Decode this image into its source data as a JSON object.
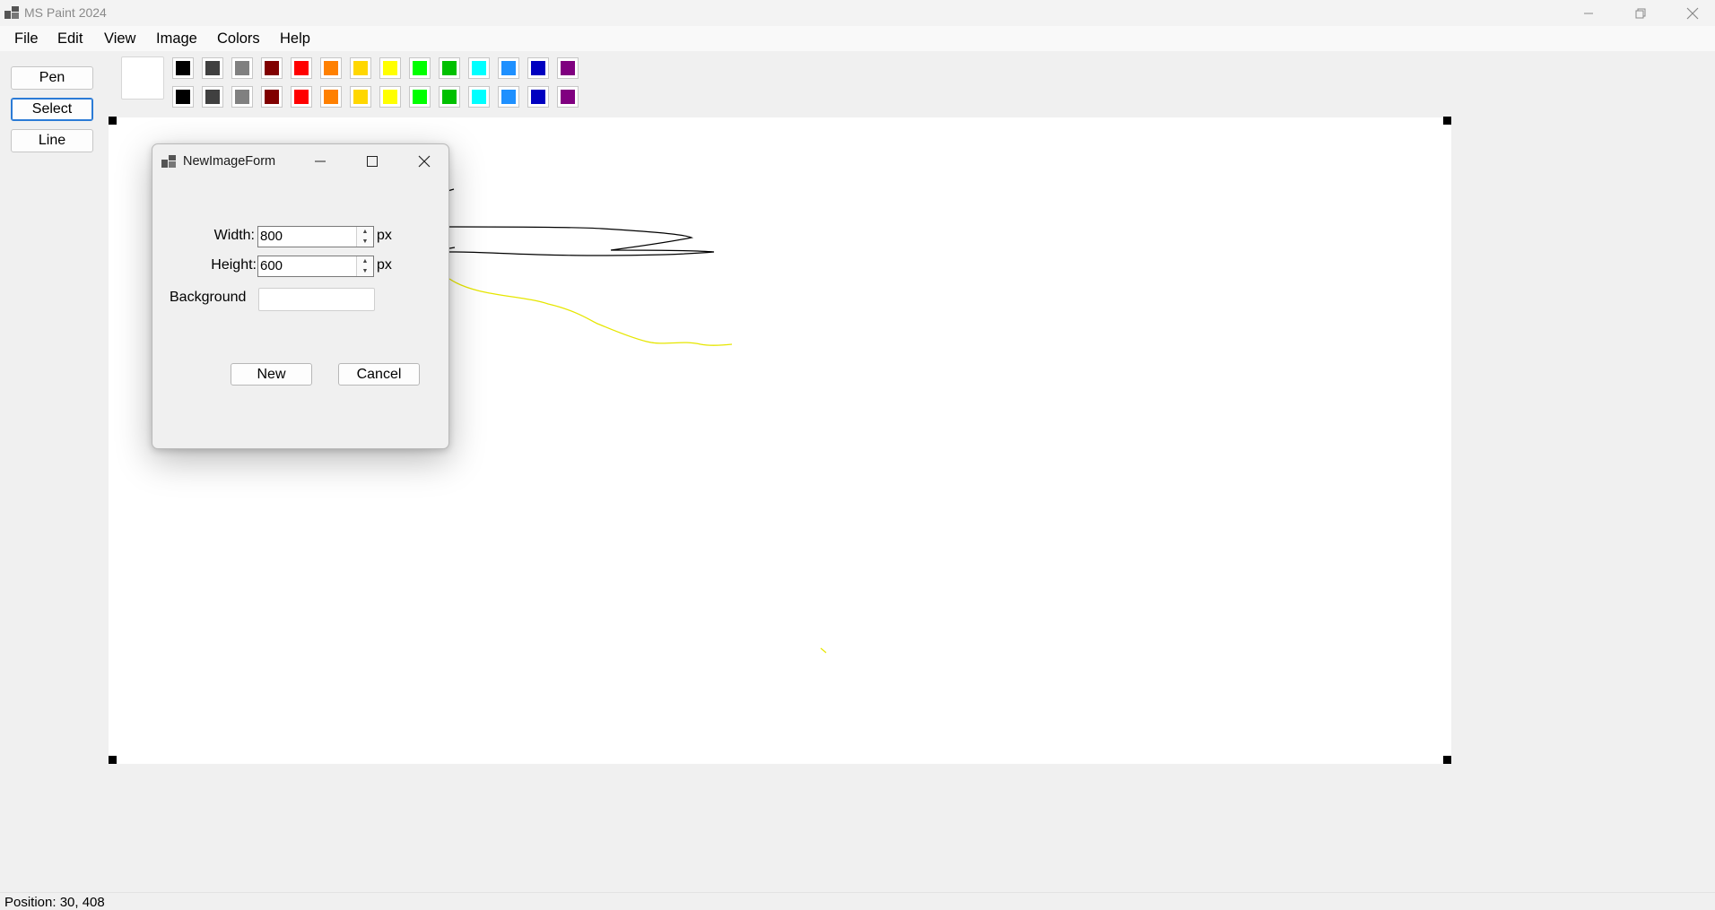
{
  "window": {
    "title": "MS Paint 2024",
    "controls": [
      "minimize-icon",
      "restore-icon",
      "close-icon"
    ]
  },
  "menu": [
    "File",
    "Edit",
    "View",
    "Image",
    "Colors",
    "Help"
  ],
  "tools": {
    "pen": "Pen",
    "select": "Select",
    "line": "Line",
    "active": "Select"
  },
  "palette": {
    "current": "#ffffff",
    "row1": [
      "#000000",
      "#404040",
      "#808080",
      "#800000",
      "#ff0000",
      "#ff8000",
      "#ffd700",
      "#ffff00",
      "#00ff00",
      "#00c000",
      "#00ffff",
      "#1e90ff",
      "#0000c0",
      "#800080"
    ],
    "row2": [
      "#000000",
      "#404040",
      "#808080",
      "#800000",
      "#ff0000",
      "#ff8000",
      "#ffd700",
      "#ffff00",
      "#00ff00",
      "#00c000",
      "#00ffff",
      "#1e90ff",
      "#0000c0",
      "#800080"
    ]
  },
  "dialog": {
    "title": "NewImageForm",
    "width_label": "Width:",
    "width_value": "800",
    "height_label": "Height:",
    "height_value": "600",
    "unit": "px",
    "background_label": "Background",
    "background_value": "",
    "new_button": "New",
    "cancel_button": "Cancel"
  },
  "status": {
    "position": "Position: 30, 408"
  },
  "colors": {
    "active_border": "#2b7bd6",
    "stroke_black": "#000000",
    "stroke_yellow": "#ffff00"
  }
}
